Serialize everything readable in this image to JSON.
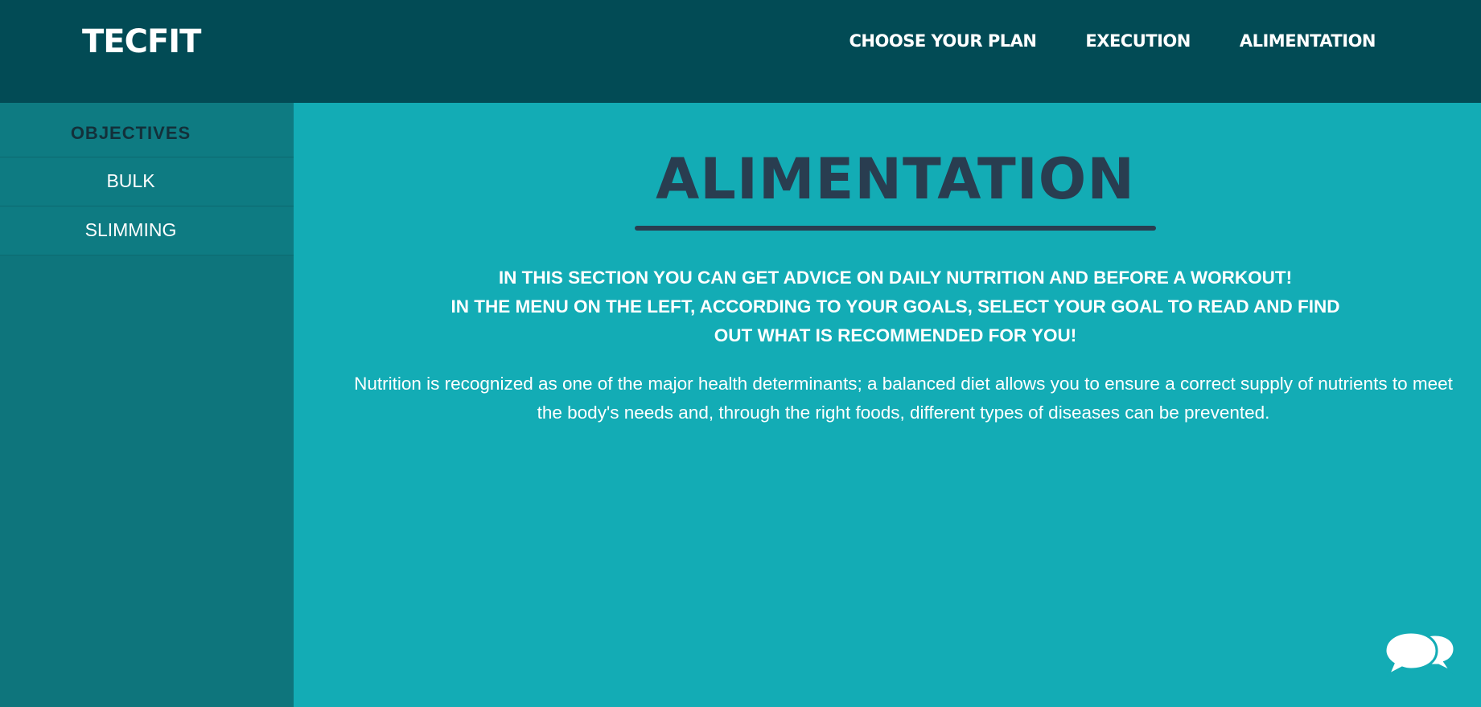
{
  "brand": {
    "name": "TECFIT"
  },
  "nav": {
    "items": [
      {
        "label": "CHOOSE YOUR PLAN"
      },
      {
        "label": "EXECUTION"
      },
      {
        "label": "ALIMENTATION"
      }
    ]
  },
  "sidebar": {
    "header": "OBJECTIVES",
    "items": [
      {
        "label": "BULK"
      },
      {
        "label": "SLIMMING"
      }
    ]
  },
  "main": {
    "title": "ALIMENTATION",
    "intro_lines": [
      "IN THIS SECTION YOU CAN GET ADVICE ON DAILY NUTRITION AND BEFORE A WORKOUT!",
      "IN THE MENU ON THE LEFT, ACCORDING TO YOUR GOALS, SELECT YOUR GOAL TO READ AND FIND",
      "OUT WHAT IS RECOMMENDED FOR YOU!"
    ],
    "body_lines": [
      "Nutrition is recognized as one of the major health determinants; a balanced diet allows you to ensure a correct supply of nutrients to meet",
      "the body's needs and, through the right foods, different types of diseases can be prevented."
    ]
  },
  "chat": {
    "icon": "chat-bubbles-icon"
  },
  "colors": {
    "navbar": "#024b55",
    "sidebar": "#0e7b82",
    "main_bg": "#13acb5",
    "title": "#293d50",
    "text": "#ffffff"
  }
}
